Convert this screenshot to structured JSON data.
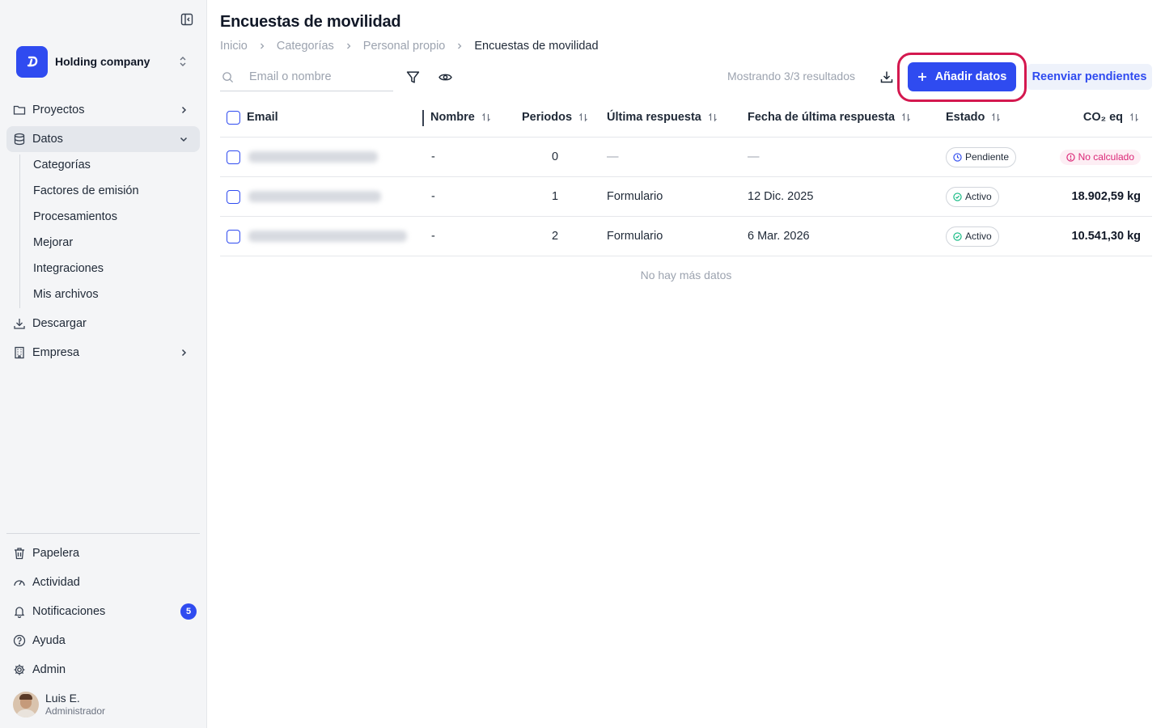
{
  "sidebar": {
    "company": {
      "name": "Holding company"
    },
    "nav": [
      {
        "label": "Proyectos"
      },
      {
        "label": "Datos"
      },
      {
        "label": "Descargar"
      },
      {
        "label": "Empresa"
      }
    ],
    "datos_sub": [
      "Categorías",
      "Factores de emisión",
      "Procesamientos",
      "Mejorar",
      "Integraciones",
      "Mis archivos"
    ],
    "bottom": [
      {
        "label": "Papelera"
      },
      {
        "label": "Actividad"
      },
      {
        "label": "Notificaciones",
        "badge": "5"
      },
      {
        "label": "Ayuda"
      },
      {
        "label": "Admin"
      }
    ],
    "user": {
      "name": "Luis E.",
      "role": "Administrador"
    }
  },
  "header": {
    "title": "Encuestas de movilidad",
    "breadcrumb": [
      "Inicio",
      "Categorías",
      "Personal propio",
      "Encuestas de movilidad"
    ]
  },
  "toolbar": {
    "search_placeholder": "Email o nombre",
    "results_text": "Mostrando 3/3 resultados",
    "add_label": "Añadir datos",
    "resend_label": "Reenviar pendientes"
  },
  "table": {
    "columns": {
      "email": "Email",
      "nombre": "Nombre",
      "periodos": "Periodos",
      "ultima_respuesta": "Última respuesta",
      "fecha": "Fecha de última respuesta",
      "estado": "Estado",
      "co2": "CO₂ eq"
    },
    "rows": [
      {
        "nombre": "-",
        "periodos": "0",
        "ultima_respuesta": "—",
        "fecha": "—",
        "estado": "Pendiente",
        "co2": "No calculado"
      },
      {
        "nombre": "-",
        "periodos": "1",
        "ultima_respuesta": "Formulario",
        "fecha": "12 Dic. 2025",
        "estado": "Activo",
        "co2": "18.902,59 kg"
      },
      {
        "nombre": "-",
        "periodos": "2",
        "ultima_respuesta": "Formulario",
        "fecha": "6 Mar. 2026",
        "estado": "Activo",
        "co2": "10.541,30 kg"
      }
    ],
    "empty_text": "No hay más datos"
  },
  "colors": {
    "accent": "#2f4bf0",
    "highlight": "#d4184f",
    "pending": "#db2777",
    "active": "#10b981"
  }
}
